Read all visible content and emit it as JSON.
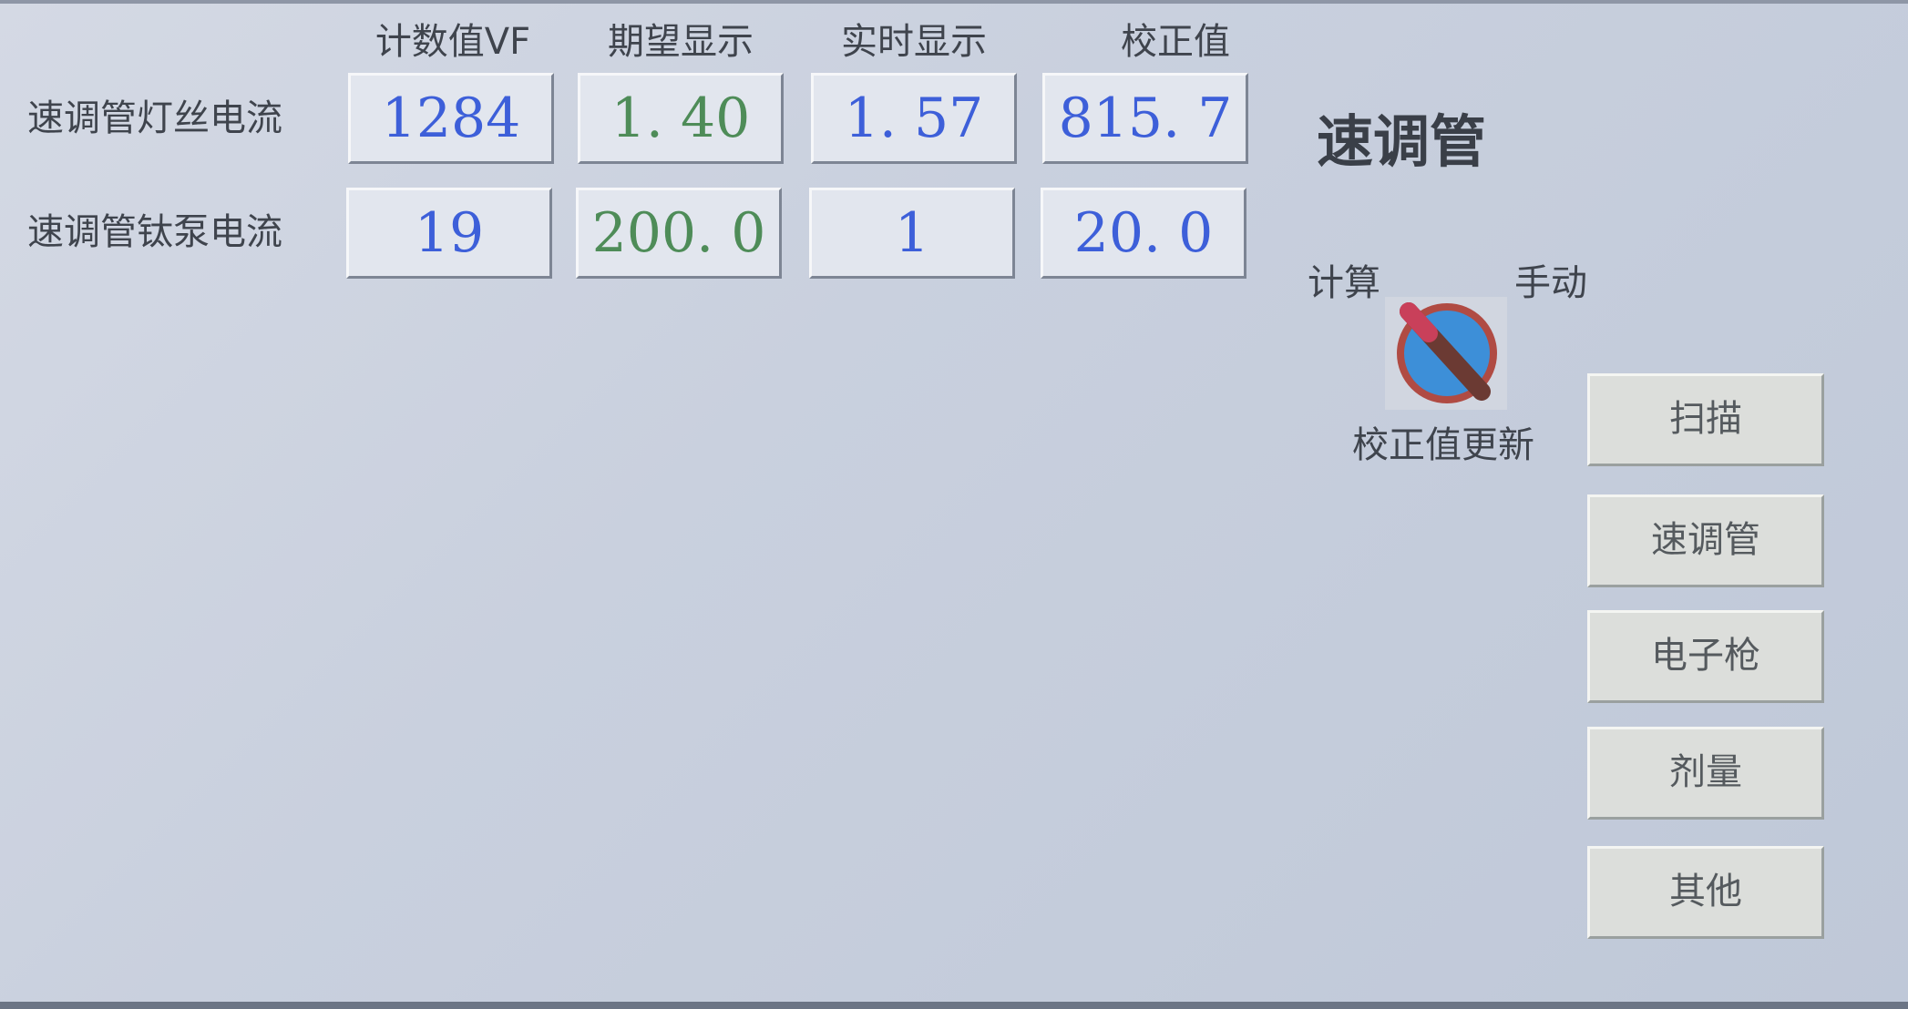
{
  "panel": {
    "title": "速调管",
    "columns": {
      "count_vf": "计数值VF",
      "expected": "期望显示",
      "realtime": "实时显示",
      "correction": "校正值"
    },
    "rows": [
      {
        "label": "速调管灯丝电流",
        "count_vf": "1284",
        "expected": "1. 40",
        "realtime": "1. 57",
        "correction": "815. 7"
      },
      {
        "label": "速调管钛泵电流",
        "count_vf": "19",
        "expected": "200. 0",
        "realtime": "1",
        "correction": "20. 0"
      }
    ]
  },
  "mode_switch": {
    "left_label": "计算",
    "right_label": "手动",
    "caption": "校正值更新",
    "position": "计算",
    "colors": {
      "dial": "#3d8fd8",
      "ring": "#b04b43",
      "lever": "#6b3a33",
      "lever_tip": "#c9405a"
    }
  },
  "nav_buttons": [
    {
      "label": "扫描"
    },
    {
      "label": "速调管"
    },
    {
      "label": "电子枪"
    },
    {
      "label": "剂量"
    },
    {
      "label": "其他"
    }
  ],
  "colors": {
    "value_blue": "#3d5fd9",
    "value_green": "#4e8c58",
    "text": "#3f444d"
  }
}
